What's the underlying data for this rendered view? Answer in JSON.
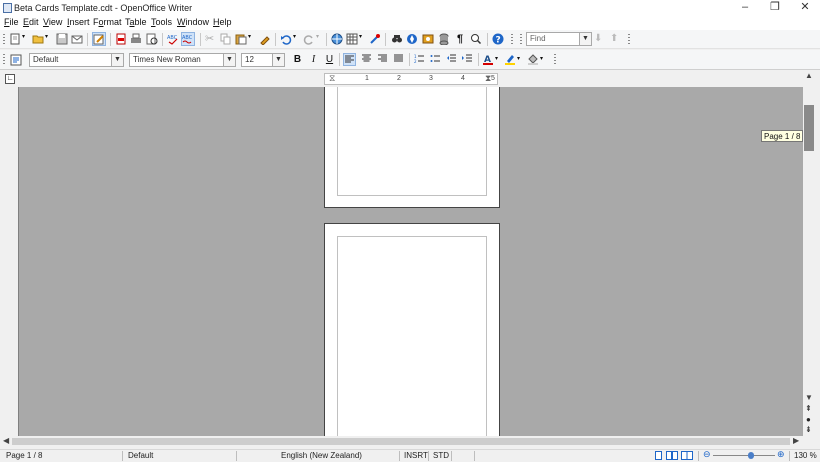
{
  "window": {
    "title": "Beta Cards Template.cdt - OpenOffice Writer",
    "minimize_glyph": "–",
    "restore_glyph": "❐",
    "close_glyph": "✕"
  },
  "menu": {
    "items": [
      {
        "label": "File",
        "accel": "F",
        "rest": "ile"
      },
      {
        "label": "Edit",
        "accel": "E",
        "rest": "dit"
      },
      {
        "label": "View",
        "accel": "V",
        "rest": "iew"
      },
      {
        "label": "Insert",
        "accel": "I",
        "rest": "nsert"
      },
      {
        "label": "Format",
        "accel": "o",
        "pre": "F",
        "rest": "rmat"
      },
      {
        "label": "Table",
        "accel": "a",
        "pre": "T",
        "rest": "ble"
      },
      {
        "label": "Tools",
        "accel": "T",
        "rest": "ools"
      },
      {
        "label": "Window",
        "accel": "W",
        "rest": "indow"
      },
      {
        "label": "Help",
        "accel": "H",
        "rest": "elp"
      }
    ]
  },
  "standard_toolbar": {
    "find_placeholder": "Find"
  },
  "formatting_toolbar": {
    "paragraph_style": "Default",
    "font_name": "Times New Roman",
    "font_size": "12",
    "bold_label": "B",
    "italic_label": "I",
    "underline_label": "U"
  },
  "ruler": {
    "labels": [
      "1",
      "2",
      "3",
      "4",
      "5"
    ]
  },
  "navigation": {
    "page_tooltip": "Page 1 / 8"
  },
  "statusbar": {
    "page": "Page 1 / 8",
    "page_style": "Default",
    "language": "English (New Zealand)",
    "insert_mode": "INSRT",
    "selection_mode": "STD",
    "zoom": "130 %",
    "zoom_level": 0.62
  },
  "colors": {
    "accent": "#1e66c8",
    "doc_background": "#a9a9a9",
    "font_color_bar": "#d40000",
    "highlight_bar": "#ffd200"
  }
}
